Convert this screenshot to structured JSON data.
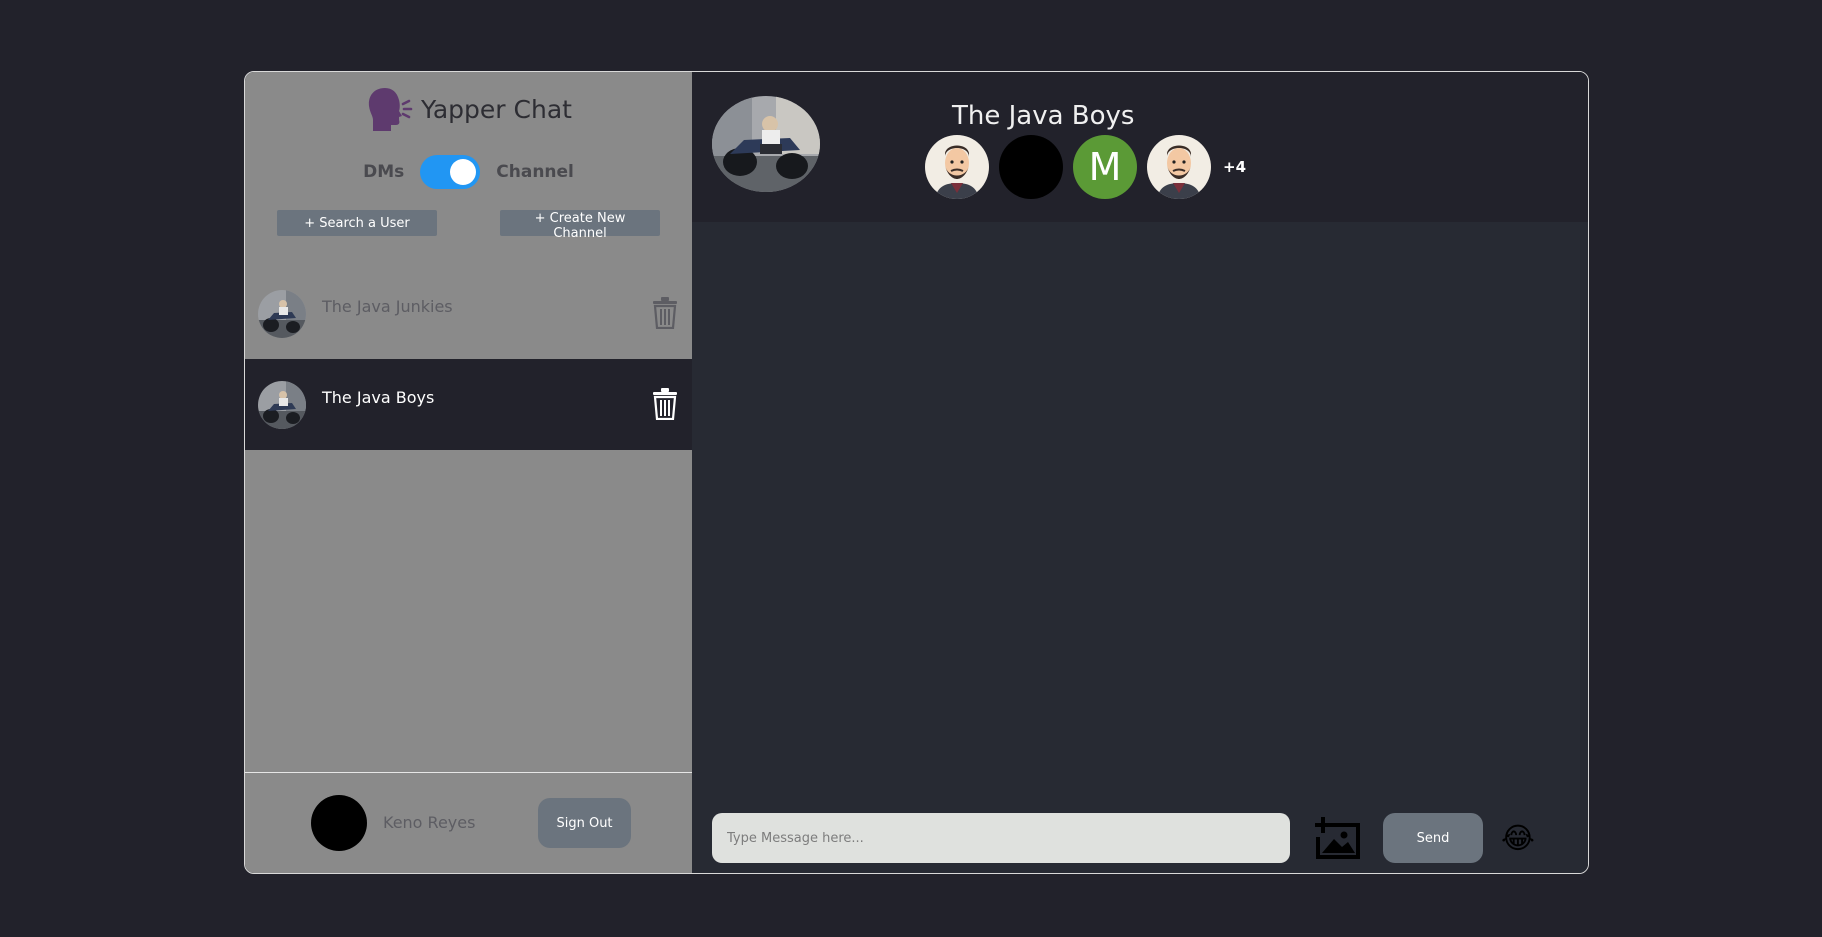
{
  "brand": {
    "title": "Yapper Chat",
    "icon": "speaking-head-icon",
    "color": "#5e3a6e"
  },
  "toggle": {
    "left_label": "DMs",
    "right_label": "Channel",
    "state": "Channel",
    "color": "#2196f3"
  },
  "sidebar": {
    "search_user_label": "+ Search a User",
    "create_channel_label": "+ Create New Channel",
    "channels": [
      {
        "name": "The Java Junkies",
        "active": false
      },
      {
        "name": "The Java Boys",
        "active": true
      }
    ]
  },
  "user": {
    "name": "Keno Reyes",
    "signout_label": "Sign Out"
  },
  "chat": {
    "title": "The Java Boys",
    "members": [
      {
        "type": "illustrated-man-avatar"
      },
      {
        "type": "blank-avatar"
      },
      {
        "type": "letter-avatar",
        "letter": "M",
        "color": "#5b9a36"
      },
      {
        "type": "illustrated-man-avatar"
      }
    ],
    "more_count": "+4",
    "input_placeholder": "Type Message here...",
    "send_label": "Send",
    "emoji": "😂"
  }
}
